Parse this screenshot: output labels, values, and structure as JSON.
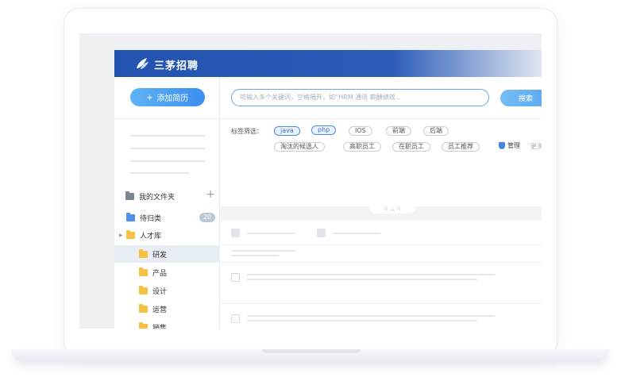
{
  "app": {
    "brand": "三茅招聘"
  },
  "sidebar": {
    "add_resume_label": "添加简历",
    "folders_title": "我的文件夹",
    "tree": [
      {
        "label": "待归类",
        "count": "20",
        "icon": "folder-blue-icon"
      },
      {
        "label": "人才库",
        "icon": "folder-yellow-icon",
        "expandable": true
      },
      {
        "label": "研发",
        "icon": "folder-yellow-icon",
        "selected": true
      },
      {
        "label": "产品",
        "icon": "folder-yellow-icon"
      },
      {
        "label": "设计",
        "icon": "folder-yellow-icon"
      },
      {
        "label": "运营",
        "icon": "folder-yellow-icon"
      },
      {
        "label": "销售",
        "icon": "folder-yellow-icon"
      }
    ]
  },
  "search": {
    "placeholder": "可输入多个关键词，空格隔开，如“HRM 通讯 薪酬绩效...",
    "button_label": "搜索"
  },
  "tags": {
    "label": "标签筛选：",
    "items": [
      "java",
      "php",
      "IOS",
      "前端",
      "后端",
      "淘汰的候选人",
      "高职员工",
      "在职员工",
      "员工推荐"
    ],
    "manage_label": "管理",
    "more_label": "更多"
  },
  "colors": {
    "header": "#2353b0",
    "accent": "#3b8ff0",
    "folder_blue": "#4e92e8",
    "folder_yellow": "#f5c242"
  }
}
